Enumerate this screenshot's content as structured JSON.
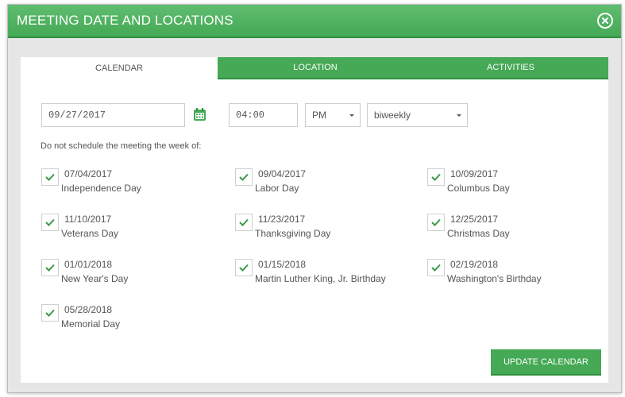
{
  "dialog": {
    "title": "MEETING DATE AND LOCATIONS",
    "close_icon": "close-circle-icon"
  },
  "tabs": [
    {
      "label": "CALENDAR",
      "active": true
    },
    {
      "label": "LOCATION",
      "active": false
    },
    {
      "label": "ACTIVITIES",
      "active": false
    }
  ],
  "form": {
    "date_value": "09/27/2017",
    "time_value": "04:00",
    "ampm_value": "PM",
    "frequency_value": "biweekly",
    "calendar_icon": "calendar-icon"
  },
  "note": "Do not schedule the meeting the week of:",
  "holidays": [
    {
      "date": "07/04/2017",
      "name": "Independence Day",
      "checked": true
    },
    {
      "date": "09/04/2017",
      "name": "Labor Day",
      "checked": true
    },
    {
      "date": "10/09/2017",
      "name": "Columbus Day",
      "checked": true
    },
    {
      "date": "11/10/2017",
      "name": "Veterans Day",
      "checked": true
    },
    {
      "date": "11/23/2017",
      "name": "Thanksgiving Day",
      "checked": true
    },
    {
      "date": "12/25/2017",
      "name": "Christmas Day",
      "checked": true
    },
    {
      "date": "01/01/2018",
      "name": "New Year's Day",
      "checked": true
    },
    {
      "date": "01/15/2018",
      "name": "Martin Luther King, Jr. Birthday",
      "checked": true
    },
    {
      "date": "02/19/2018",
      "name": "Washington's Birthday",
      "checked": true
    },
    {
      "date": "05/28/2018",
      "name": "Memorial Day",
      "checked": true
    }
  ],
  "update_button": "UPDATE CALENDAR",
  "colors": {
    "accent": "#45a955",
    "accent_dark": "#2f8f3f",
    "text": "#555555",
    "check": "#3a9a48"
  }
}
